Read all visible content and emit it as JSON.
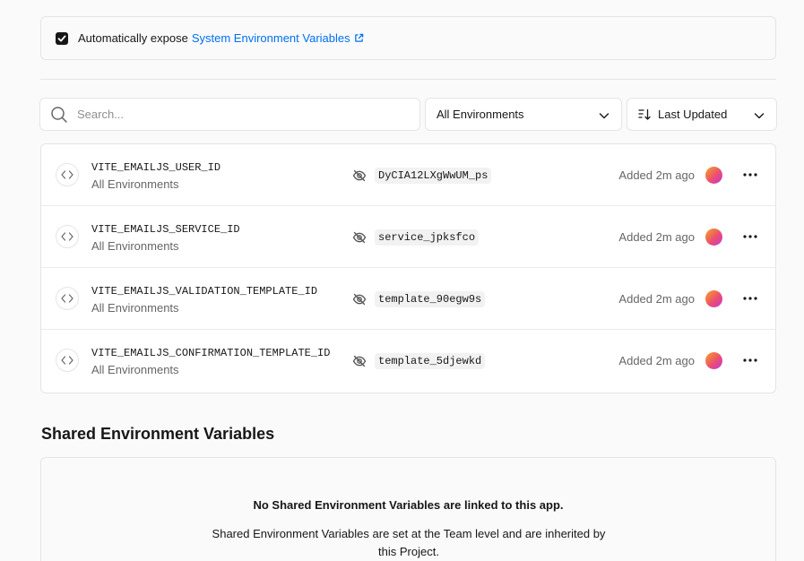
{
  "expose": {
    "checked": true,
    "label": "Automatically expose",
    "link_text": "System Environment Variables"
  },
  "search": {
    "placeholder": "Search..."
  },
  "filters": {
    "environment": "All Environments",
    "sort": "Last Updated"
  },
  "variables": [
    {
      "name": "VITE_EMAILJS_USER_ID",
      "environment": "All Environments",
      "value": "DyCIA12LXgWwUM_ps",
      "added": "Added 2m ago"
    },
    {
      "name": "VITE_EMAILJS_SERVICE_ID",
      "environment": "All Environments",
      "value": "service_jpksfco",
      "added": "Added 2m ago"
    },
    {
      "name": "VITE_EMAILJS_VALIDATION_TEMPLATE_ID",
      "environment": "All Environments",
      "value": "template_90egw9s",
      "added": "Added 2m ago"
    },
    {
      "name": "VITE_EMAILJS_CONFIRMATION_TEMPLATE_ID",
      "environment": "All Environments",
      "value": "template_5djewkd",
      "added": "Added 2m ago"
    }
  ],
  "shared": {
    "title": "Shared Environment Variables",
    "empty_heading": "No Shared Environment Variables are linked to this app.",
    "empty_description": "Shared Environment Variables are set at the Team level and are inherited by this Project."
  },
  "colors": {
    "link": "#0070f3",
    "text": "#171717",
    "muted": "#666666",
    "border": "#e5e5e5"
  },
  "icons": [
    "checkmark-icon",
    "external-link-icon",
    "search-icon",
    "chevron-down-icon",
    "sort-icon",
    "code-icon",
    "eye-off-icon",
    "more-horizontal-icon"
  ]
}
